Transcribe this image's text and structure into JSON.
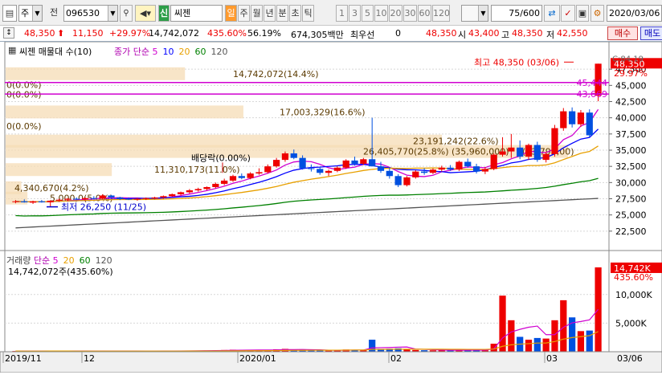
{
  "toolbar": {
    "market_type": "주",
    "jeon_label": "전",
    "code": "096530",
    "stock_badge": "신",
    "stock_name": "씨젠",
    "periods": [
      "일",
      "주",
      "월",
      "년",
      "분",
      "초",
      "틱"
    ],
    "active_period": "일",
    "intervals": [
      "1",
      "3",
      "5",
      "10",
      "20",
      "30",
      "60",
      "120"
    ],
    "count": "75",
    "count_total": "/600",
    "date": "2020/03/06"
  },
  "quote": {
    "price": "48,350",
    "change": "11,150",
    "change_pct": "+29.97%",
    "volume": "14,742,072",
    "volume_ratio": "435.60%",
    "turnover": "56.19%",
    "amount": "674,305백만",
    "preferred_label": "최우선",
    "preferred_value": "0",
    "ask": "48,350",
    "open_label": "시",
    "open": "43,400",
    "high_label": "고",
    "high": "48,350",
    "low_label": "저",
    "low": "42,550",
    "buy_button": "매수",
    "sell_button": "매도"
  },
  "chart_header": {
    "title": "씨젠 매물대 수(10)",
    "ma_label": "종가 단순",
    "ma_periods": [
      "5",
      "10",
      "20",
      "60",
      "120"
    ],
    "ma_colors": [
      "#d000d0",
      "#0000ff",
      "#e8a000",
      "#008000",
      "#555555"
    ],
    "icon": "gear-icon"
  },
  "annotations": {
    "high": "최고 48,350 (03/06)",
    "low": "최저 26,250 (11/25)",
    "dividend": "배당락(0.00%)",
    "price_tag": "48,350",
    "pct_tag": "29.97%",
    "line1": "45,444",
    "line2": "43,669",
    "cur_prefix": "C:",
    "cur_value": "84.19"
  },
  "profile_bars": [
    {
      "label": "14,742,072(14.4%)",
      "value": 14742072,
      "pct": 14.4
    },
    {
      "label": "0(0.0%)",
      "value": 0,
      "pct": 0.0
    },
    {
      "label": "0(0.0%)",
      "value": 0,
      "pct": 0.0
    },
    {
      "label": "17,003,329(16.6%)",
      "value": 17003329,
      "pct": 16.6
    },
    {
      "label": "0(0.0%)",
      "value": 0,
      "pct": 0.0
    },
    {
      "label": "23,191,242(22.6%)",
      "value": 23191242,
      "pct": 22.6
    },
    {
      "label": "26,405,770(25.8%)",
      "value": 26405770,
      "pct": 25.8
    },
    {
      "label": "(35,960,000)",
      "value": 35960000,
      "pct": null
    },
    {
      "label": "(33,795,00)",
      "value": 33795000,
      "pct": null
    },
    {
      "label": "11,310,173(11.0%)",
      "value": 11310173,
      "pct": 11.0
    },
    {
      "label": "4,340,670(4.2%)",
      "value": 4340670,
      "pct": 4.2
    },
    {
      "label": "5,000,0(5.0%)",
      "value": 5000000,
      "pct": 5.0
    }
  ],
  "price_axis": [
    "47,500",
    "45,000",
    "42,500",
    "40,000",
    "37,500",
    "35,000",
    "32,500",
    "30,000",
    "27,500",
    "25,000",
    "22,500"
  ],
  "volume_header": {
    "title": "거래량",
    "ma_label": "단순",
    "ma_periods": [
      "5",
      "20",
      "60",
      "120"
    ],
    "ma_colors": [
      "#d000d0",
      "#e8a000",
      "#008000",
      "#555555"
    ],
    "value": "14,742,072주(435.60%)",
    "tag_value": "14,742K",
    "tag_pct": "435.60%"
  },
  "volume_axis": [
    "10,000K",
    "5,000K"
  ],
  "date_axis": [
    "2019/11",
    "12",
    "2020/01",
    "02",
    "03",
    "03/06"
  ],
  "chart_data": {
    "type": "candlestick",
    "title": "씨젠 매물대 수(10)",
    "ylim": [
      20000,
      50000
    ],
    "volume_ylim": [
      0,
      16000000
    ],
    "date_labels": [
      "2019/11",
      "12",
      "2020/01",
      "02",
      "03"
    ],
    "last_date": "03/06",
    "candles": [
      [
        27000,
        27300,
        26800,
        27100
      ],
      [
        27100,
        27400,
        26900,
        26950
      ],
      [
        26900,
        27200,
        26700,
        27100
      ],
      [
        27100,
        27300,
        26900,
        26950
      ],
      [
        26950,
        27250,
        26250,
        27200
      ],
      [
        27200,
        27500,
        27000,
        27350
      ],
      [
        27350,
        27600,
        27100,
        27500
      ],
      [
        27500,
        27700,
        27300,
        27400
      ],
      [
        27400,
        27700,
        27200,
        27600
      ],
      [
        27600,
        27900,
        27400,
        27500
      ],
      [
        27500,
        28200,
        27400,
        28000
      ],
      [
        28000,
        28100,
        27600,
        27700
      ],
      [
        27700,
        27800,
        27300,
        27500
      ],
      [
        27500,
        27700,
        27300,
        27400
      ],
      [
        27400,
        27600,
        27200,
        27500
      ],
      [
        27500,
        27700,
        27300,
        27600
      ],
      [
        27600,
        27800,
        27400,
        27700
      ],
      [
        27700,
        28000,
        27500,
        27900
      ],
      [
        27900,
        28300,
        27800,
        28200
      ],
      [
        28200,
        28600,
        28000,
        28500
      ],
      [
        28500,
        29000,
        28300,
        28800
      ],
      [
        28800,
        29200,
        28600,
        29000
      ],
      [
        29000,
        29400,
        28800,
        29300
      ],
      [
        29300,
        30000,
        29100,
        29800
      ],
      [
        29800,
        30600,
        29600,
        30300
      ],
      [
        30300,
        31200,
        30100,
        31000
      ],
      [
        31000,
        31400,
        30500,
        30700
      ],
      [
        30700,
        31600,
        30500,
        31400
      ],
      [
        31400,
        32200,
        31200,
        31600
      ],
      [
        31600,
        32800,
        31400,
        32500
      ],
      [
        32500,
        33800,
        32300,
        33500
      ],
      [
        33500,
        34800,
        33200,
        34500
      ],
      [
        34500,
        35100,
        33600,
        33800
      ],
      [
        33800,
        34200,
        32000,
        32200
      ],
      [
        32200,
        32800,
        31700,
        32100
      ],
      [
        32100,
        32400,
        31200,
        31500
      ],
      [
        31500,
        32000,
        31000,
        31800
      ],
      [
        31800,
        32500,
        31600,
        32300
      ],
      [
        32300,
        33600,
        32100,
        33400
      ],
      [
        33400,
        34000,
        32600,
        32900
      ],
      [
        32900,
        33800,
        32700,
        33600
      ],
      [
        33600,
        40000,
        33200,
        32500
      ],
      [
        32500,
        33200,
        31500,
        31800
      ],
      [
        31800,
        32300,
        30600,
        31000
      ],
      [
        31000,
        31300,
        29300,
        29600
      ],
      [
        29600,
        31000,
        29400,
        30800
      ],
      [
        30800,
        31900,
        30600,
        31700
      ],
      [
        31700,
        32200,
        31200,
        31500
      ],
      [
        31500,
        32200,
        31300,
        32000
      ],
      [
        32000,
        32600,
        31700,
        32300
      ],
      [
        32300,
        32700,
        31800,
        32000
      ],
      [
        32000,
        33400,
        31800,
        33200
      ],
      [
        33200,
        33700,
        32300,
        32500
      ],
      [
        32500,
        32900,
        31400,
        31700
      ],
      [
        31700,
        32400,
        31300,
        32100
      ],
      [
        32100,
        34500,
        31900,
        34300
      ],
      [
        34300,
        37000,
        34000,
        34800
      ],
      [
        34800,
        37500,
        33800,
        35400
      ],
      [
        35400,
        36500,
        33600,
        34000
      ],
      [
        34000,
        36000,
        33500,
        35800
      ],
      [
        35800,
        36300,
        33200,
        33500
      ],
      [
        33500,
        34700,
        33100,
        34400
      ],
      [
        34400,
        38900,
        34000,
        38400
      ],
      [
        38400,
        41500,
        38000,
        41000
      ],
      [
        41000,
        41600,
        38500,
        39000
      ],
      [
        39000,
        41200,
        38600,
        40800
      ],
      [
        40800,
        41300,
        37000,
        37300
      ],
      [
        43400,
        48350,
        42550,
        48350
      ]
    ],
    "volumes": [
      120000,
      100000,
      90000,
      110000,
      180000,
      130000,
      100000,
      90000,
      100000,
      110000,
      160000,
      110000,
      100000,
      90000,
      90000,
      100000,
      110000,
      120000,
      140000,
      170000,
      200000,
      180000,
      190000,
      230000,
      300000,
      350000,
      250000,
      320000,
      260000,
      340000,
      420000,
      500000,
      320000,
      350000,
      220000,
      280000,
      200000,
      240000,
      380000,
      330000,
      260000,
      2100000,
      500000,
      520000,
      600000,
      380000,
      300000,
      260000,
      250000,
      270000,
      230000,
      330000,
      260000,
      300000,
      250000,
      1400000,
      9800000,
      5500000,
      2600000,
      2100000,
      2400000,
      2300000,
      5500000,
      9000000,
      6000000,
      3600000,
      3700000,
      14742072
    ]
  }
}
